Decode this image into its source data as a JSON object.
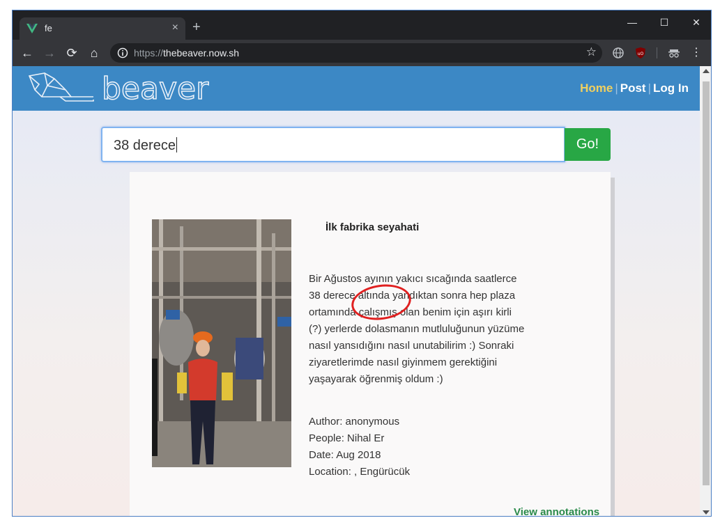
{
  "browser": {
    "tab_title": "fe",
    "new_tab_symbol": "+",
    "tab_close_symbol": "×",
    "url_scheme": "https://",
    "url_host": "thebeaver.now.sh",
    "window_controls": {
      "minimize": "—",
      "maximize": "☐",
      "close": "✕"
    },
    "icons": [
      "back-icon",
      "forward-icon",
      "reload-icon",
      "home-icon",
      "info-icon",
      "star-icon",
      "globe-icon",
      "ublock-icon",
      "incognito-icon",
      "menu-icon"
    ]
  },
  "site": {
    "logo_text": "beaver",
    "nav": {
      "home": "Home",
      "post": "Post",
      "login": "Log In"
    },
    "colors": {
      "navbar": "#3c88c5",
      "active_nav": "#f0d060",
      "go_button": "#28a745",
      "link": "#2a8a4a",
      "highlight_circle": "#e02020"
    }
  },
  "search": {
    "value": "38 derece",
    "button_label": "Go!"
  },
  "post": {
    "title": "İlk fabrika seyahati",
    "body": "Bir Ağustos ayının yakıcı sıcağında saatlerce 38 derece altında yandıktan sonra hep plaza ortamında çalışmış olan benim için aşırı kirli (?) yerlerde dolasmanın mutluluğunun yüzüme nasıl yansıdığını nasıl unutabilirim :) Sonraki ziyaretlerimde nasıl giyinmem gerektiğini yaşayarak öğrenmiş oldum :)",
    "author": "Author: anonymous",
    "people": "People: Nihal Er",
    "date": "Date: Aug 2018",
    "location": "Location: , Engürücük",
    "view_annotations": "View annotations"
  }
}
